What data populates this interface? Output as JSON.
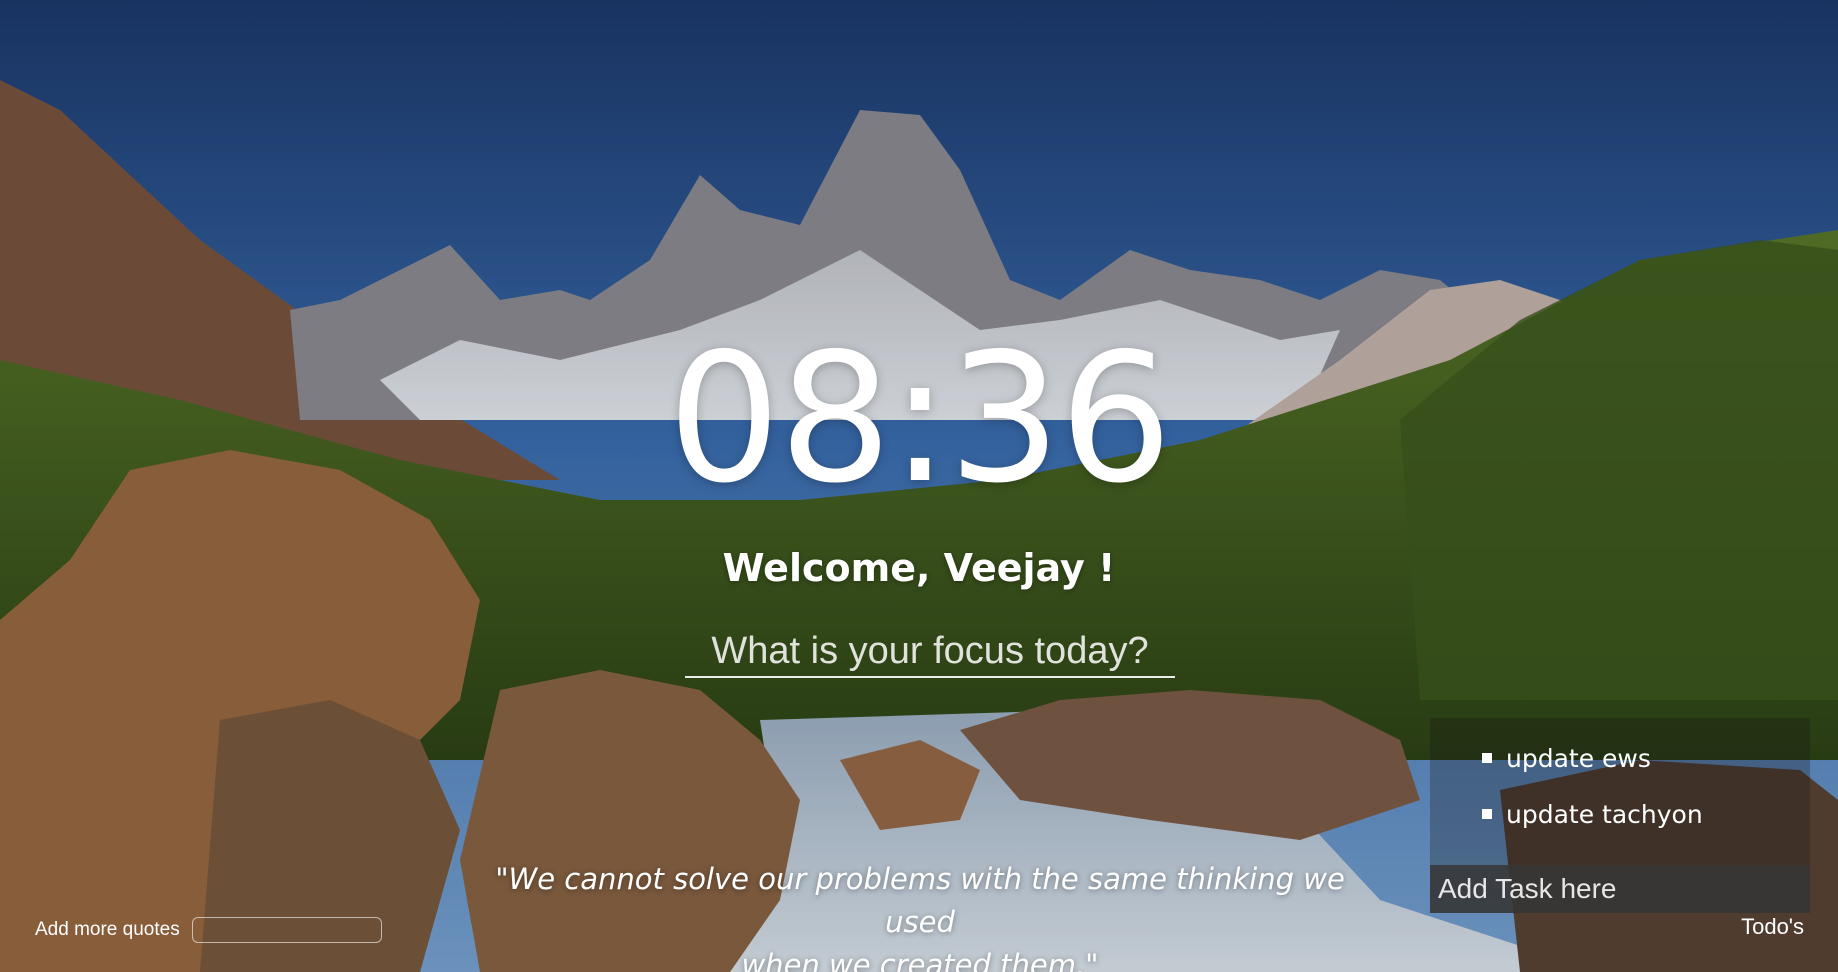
{
  "clock": {
    "time": "08:36"
  },
  "greeting": {
    "text": "Welcome, Veejay !"
  },
  "focus": {
    "placeholder": "What is your focus today?"
  },
  "quote": {
    "line1": "\"We cannot solve our problems with the same thinking we used",
    "line2": "when we created them.\""
  },
  "add_quotes": {
    "label": "Add more quotes",
    "value": ""
  },
  "todos": {
    "items": [
      {
        "label": "update ews"
      },
      {
        "label": "update tachyon"
      }
    ],
    "input_placeholder": "Add Task here",
    "toggle_label": "Todo's"
  },
  "icons": {
    "todo_checkbox": "square-checkbox-icon"
  },
  "colors": {
    "sky_top": "#1c3a6e",
    "sky_bottom": "#4d84c4",
    "text": "#ffffff",
    "panel": "#141414"
  }
}
